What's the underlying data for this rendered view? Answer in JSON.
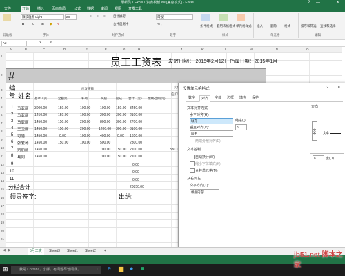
{
  "window": {
    "doc_title": "最新员工Excel工资表模板.xls [兼容模式] - Excel",
    "controls": [
      "?",
      "—",
      "□",
      "✕"
    ]
  },
  "ribbon": {
    "tabs": [
      "文件",
      "开始",
      "插入",
      "页面布局",
      "公式",
      "数据",
      "审阅",
      "视图",
      "开发工具"
    ],
    "font_name": "微软雅黑 Light",
    "font_size": "28",
    "wrap_label": "自动换行",
    "number_format": "常规",
    "merge_label": "合并后居中",
    "groups": [
      "剪贴板",
      "字体",
      "对齐方式",
      "数字",
      "样式",
      "单元格",
      "编辑"
    ],
    "right_buttons": [
      "条件格式",
      "套用表格格式",
      "单元格样式",
      "插入",
      "删除",
      "格式",
      "排序和筛选",
      "查找和选择"
    ]
  },
  "formula_bar": {
    "name_box": "A2",
    "fx": "fx",
    "value": "#"
  },
  "columns": [
    "A",
    "B",
    "C",
    "D",
    "E",
    "F",
    "G",
    "H",
    "I",
    "J",
    "K",
    "L",
    "M",
    "N",
    "O"
  ],
  "rows": [
    "1",
    "2",
    "3",
    "4",
    "5",
    "6",
    "7",
    "8",
    "9",
    "10",
    "11",
    "12",
    "13",
    "14",
    "15",
    "16",
    "17",
    "18",
    "19",
    "20",
    "21",
    "22",
    "23"
  ],
  "sheet": {
    "title": "员工工资表",
    "release_label": "发放日期：",
    "release_value": "2015年2月12日 所属日期：2015年1月",
    "selected_cell": "#",
    "header_left": "编号",
    "header_name": "姓名",
    "header_group": "应发金额",
    "header_cols": [
      "基本工资",
      "全勤奖",
      "补助",
      "奖励",
      "提成",
      "合计（元）",
      "缴纳社保(元)"
    ],
    "header_right": "实际",
    "header_right2": "应扣和代",
    "rows": [
      {
        "no": "1",
        "name": "马亚丽",
        "base": "3000.00",
        "full": "150.00",
        "sub": "100.00",
        "award": "100.00",
        "commission": "150.00",
        "total": "3450.00",
        "social": ""
      },
      {
        "no": "2",
        "name": "马亚丽",
        "base": "1450.00",
        "full": "150.00",
        "sub": "100.00",
        "award": "200.00",
        "commission": "300.00",
        "total": "2100.00",
        "social": ""
      },
      {
        "no": "3",
        "name": "马亚丽",
        "base": "1450.00",
        "full": "150.00",
        "sub": "200.00",
        "award": "800.00",
        "commission": "300.00",
        "total": "2700.00",
        "social": ""
      },
      {
        "no": "4",
        "name": "王卫丽",
        "base": "1450.00",
        "full": "150.00",
        "sub": "200.00",
        "award": "1200.00",
        "commission": "300.00",
        "total": "3100.00",
        "social": ""
      },
      {
        "no": "5",
        "name": "可潘",
        "base": "1450.00",
        "full": "0.00",
        "sub": "100.00",
        "award": "400.00",
        "commission": "0.00",
        "total": "1650.00",
        "social": ""
      },
      {
        "no": "6",
        "name": "张爱琴",
        "base": "1450.00",
        "full": "150.00",
        "sub": "100.00",
        "award": "500.00",
        "commission": "",
        "total": "2300.00",
        "social": ""
      },
      {
        "no": "7",
        "name": "刘丽丽",
        "base": "1450.00",
        "full": "",
        "sub": "700.00",
        "award": "150.00",
        "commission": "",
        "total": "2100.00",
        "social": "330.00"
      },
      {
        "no": "8",
        "name": "葛同",
        "base": "1450.00",
        "full": "",
        "sub": "700.00",
        "award": "150.00",
        "commission": "",
        "total": "2100.00",
        "social": ""
      },
      {
        "no": "9",
        "name": "",
        "base": "",
        "full": "",
        "sub": "",
        "award": "",
        "commission": "",
        "total": "0.00",
        "social": ""
      },
      {
        "no": "10",
        "name": "",
        "base": "",
        "full": "",
        "sub": "",
        "award": "",
        "commission": "",
        "total": "0.00",
        "social": ""
      },
      {
        "no": "11",
        "name": "",
        "base": "",
        "full": "",
        "sub": "",
        "award": "",
        "commission": "",
        "total": "0.00",
        "social": ""
      }
    ],
    "subtotal_label": "分栏合计",
    "subtotal_value": "20850.00",
    "sign_label": "领导签字:",
    "cashier_label": "出纳:"
  },
  "dialog": {
    "title": "设置单元格格式",
    "help": "?",
    "close": "✕",
    "tabs": [
      "数字",
      "对齐",
      "字体",
      "边框",
      "填充",
      "保护"
    ],
    "section_align": "文本对齐方式",
    "horizontal_label": "水平对齐(H):",
    "horizontal_value": "填充",
    "indent_label": "缩进(I):",
    "indent_value": "0",
    "vertical_label": "垂直对齐(V):",
    "vertical_value": "居中",
    "justify_distributed": "两端分散对齐(E)",
    "section_control": "文本控制",
    "wrap": "自动换行(W)",
    "shrink": "缩小字体填充(K)",
    "merge": "合并单元格(M)",
    "section_rtl": "从右到左",
    "direction_label": "文字方向(T):",
    "direction_value": "根据内容",
    "orient_label": "方向",
    "orient_text": "文本",
    "degree_value": "0",
    "degree_label": "度(D)"
  },
  "sheet_tabs": [
    "5月工资",
    "Sheet3",
    "Sheet1",
    "Sheet2",
    "+"
  ],
  "taskbar": {
    "search_text": "我是 Cortana，小娜。有问题尽管问我。"
  },
  "watermark": "jb51.net 脚本之家"
}
